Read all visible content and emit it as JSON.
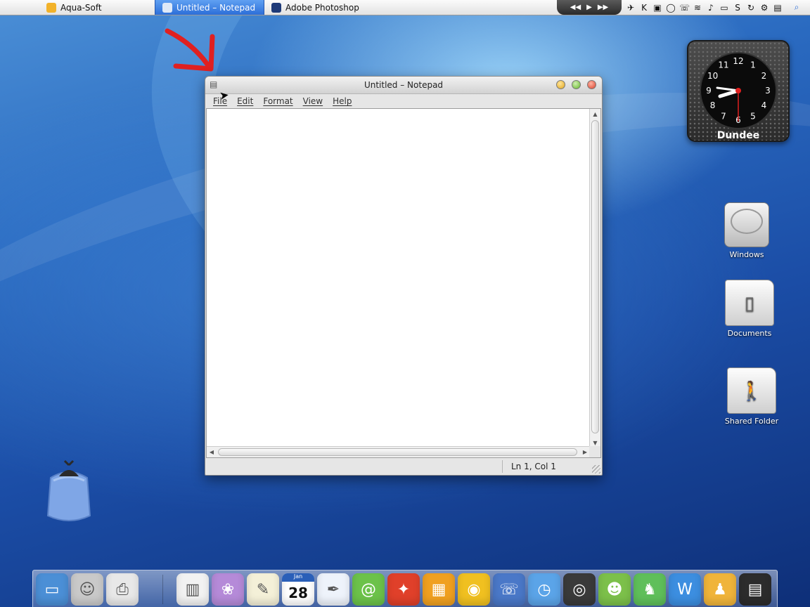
{
  "taskbar": {
    "tasks": [
      {
        "label": "Aqua-Soft",
        "icon": "aqua-soft-icon",
        "color": "#f2b22a"
      },
      {
        "label": "Untitled – Notepad",
        "icon": "notepad-icon",
        "color": "#dfe9f7",
        "active": true
      },
      {
        "label": "Adobe Photoshop",
        "icon": "photoshop-icon",
        "color": "#1e3a78"
      }
    ]
  },
  "notepad": {
    "title": "Untitled – Notepad",
    "menu": [
      "File",
      "Edit",
      "Format",
      "View",
      "Help"
    ],
    "status": "Ln 1, Col 1"
  },
  "clock": {
    "city": "Dundee",
    "numbers": [
      "12",
      "1",
      "2",
      "3",
      "4",
      "5",
      "6",
      "7",
      "8",
      "9",
      "10",
      "11"
    ]
  },
  "desktop_icons": [
    {
      "label": "Windows",
      "icon": "hard-drive-icon"
    },
    {
      "label": "Documents",
      "icon": "documents-folder-icon"
    },
    {
      "label": "Shared Folder",
      "icon": "shared-folder-icon"
    }
  ],
  "dock": {
    "calendar": {
      "month": "Jan",
      "day": "28"
    },
    "items": [
      {
        "icon": "display-icon",
        "color": "#4b8fd6"
      },
      {
        "icon": "finder-icon",
        "color": "#c9c9c9"
      },
      {
        "icon": "printer-icon",
        "color": "#e8e8e8"
      },
      {
        "icon": "toaster-icon",
        "color": "#f2f2f2"
      },
      {
        "icon": "photo-album-icon",
        "color": "#b58ad8"
      },
      {
        "icon": "notes-icon",
        "color": "#f4f0d8"
      },
      {
        "icon": "calendar-icon",
        "color": "#ffffff"
      },
      {
        "icon": "writing-icon",
        "color": "#eef3fb"
      },
      {
        "icon": "mail-icon",
        "color": "#6cc24a"
      },
      {
        "icon": "game-icon",
        "color": "#e0402a"
      },
      {
        "icon": "box-icon",
        "color": "#f0a020"
      },
      {
        "icon": "speaker-icon",
        "color": "#f0c020"
      },
      {
        "icon": "chat-icon",
        "color": "#4a78c8"
      },
      {
        "icon": "safari-icon",
        "color": "#5ba4e8"
      },
      {
        "icon": "dvd-icon",
        "color": "#3a3a3a"
      },
      {
        "icon": "frog-icon",
        "color": "#7cc04a"
      },
      {
        "icon": "elephant-icon",
        "color": "#5fbf5a"
      },
      {
        "icon": "word-icon",
        "color": "#3c8ee0"
      },
      {
        "icon": "mascot-icon",
        "color": "#f0b43a"
      },
      {
        "icon": "clapper-icon",
        "color": "#2c2c2c"
      }
    ]
  }
}
